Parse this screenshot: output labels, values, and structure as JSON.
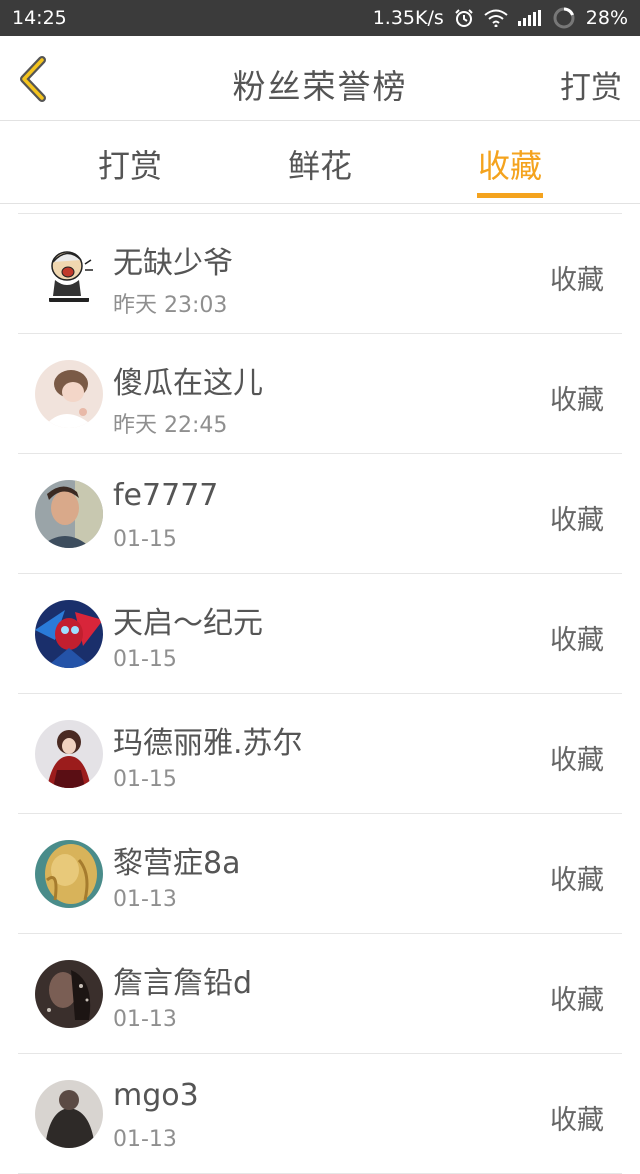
{
  "status_bar": {
    "time": "14:25",
    "network_speed": "1.35K/s",
    "battery": "28%",
    "icons": [
      "alarm-icon",
      "wifi-icon",
      "signal-icon",
      "battery-icon"
    ]
  },
  "nav": {
    "back_icon": "chevron-left-icon",
    "title": "粉丝荣誉榜",
    "action": "打赏"
  },
  "tabs": [
    {
      "label": "打赏",
      "active": false
    },
    {
      "label": "鲜花",
      "active": false
    },
    {
      "label": "收藏",
      "active": true
    }
  ],
  "colors": {
    "accent": "#f4a31e",
    "status_bar_bg": "#3b3b3b",
    "text": "#555555",
    "subtext": "#8f8f8f",
    "divider": "#e6e6e6"
  },
  "list": [
    {
      "name": "无缺少爷",
      "date": "昨天 23:03",
      "type": "收藏"
    },
    {
      "name": "傻瓜在这儿",
      "date": "昨天 22:45",
      "type": "收藏"
    },
    {
      "name": "fe7777",
      "date": "01-15",
      "type": "收藏"
    },
    {
      "name": "天启～纪元",
      "date": "01-15",
      "type": "收藏"
    },
    {
      "name": "玛德丽雅.苏尔",
      "date": "01-15",
      "type": "收藏"
    },
    {
      "name": "黎营症8a",
      "date": "01-13",
      "type": "收藏"
    },
    {
      "name": "詹言詹铅d",
      "date": "01-13",
      "type": "收藏"
    },
    {
      "name": "mgo3",
      "date": "01-13",
      "type": "收藏"
    }
  ]
}
